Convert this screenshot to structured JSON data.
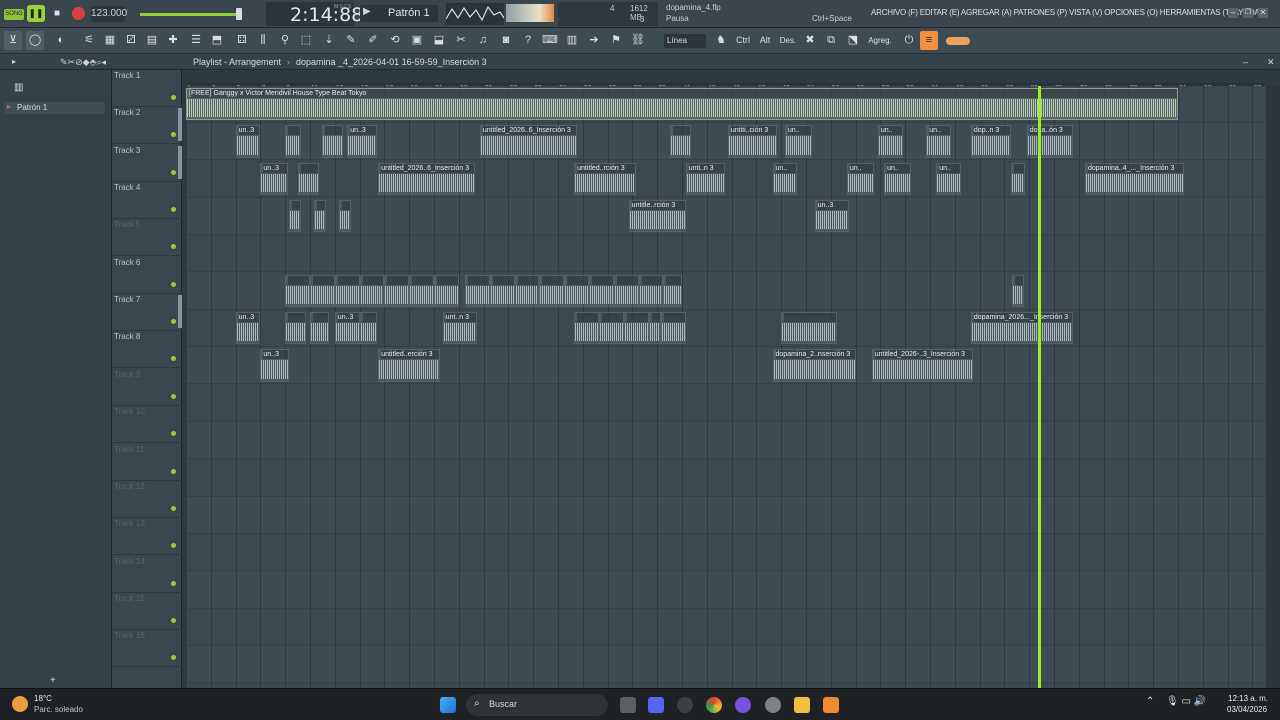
{
  "topbar": {
    "song_mode": "SONG",
    "tempo": "123.000",
    "time": "2:14:88",
    "time_unit": "M:S:CS",
    "pattern": "Patrón 1",
    "cpu": "4",
    "memory": "1612 MB",
    "polyphony": "3",
    "file": "dopamina_4.flp",
    "status": "Pausa",
    "hint": "Ctrl+Space",
    "menu": "ARCHIVO (F) EDITAR (E) AGREGAR (A) PATRONES (P) VISTA (V) OPCIONES (O) HERRAMIENTAS (T) AYUDA"
  },
  "toolbar": {
    "line_mode": "Línea",
    "ctrl": "Ctrl",
    "alt": "Alt",
    "des": "Des.",
    "agreg": "Agreg."
  },
  "playlist": {
    "title": "Playlist - Arrangement",
    "breadcrumb": "dopamina _4_2026-04-01 16-59-59_Inserción 3"
  },
  "browser": {
    "pattern": "Patrón 1"
  },
  "tracks": [
    {
      "name": "Track 1"
    },
    {
      "name": "Track 2"
    },
    {
      "name": "Track 3"
    },
    {
      "name": "Track 4"
    },
    {
      "name": "Track 5",
      "muted": true
    },
    {
      "name": "Track 6"
    },
    {
      "name": "Track 7"
    },
    {
      "name": "Track 8"
    },
    {
      "name": "Track 9",
      "muted": true
    },
    {
      "name": "Track 10",
      "muted": true
    },
    {
      "name": "Track 11",
      "muted": true
    },
    {
      "name": "Track 12",
      "muted": true
    },
    {
      "name": "Track 13",
      "muted": true
    },
    {
      "name": "Track 14",
      "muted": true
    },
    {
      "name": "Track 15",
      "muted": true
    },
    {
      "name": "Track 16",
      "muted": true
    }
  ],
  "ruler": [
    "1",
    "3",
    "5",
    "7",
    "9",
    "11",
    "13",
    "15",
    "17",
    "19",
    "21",
    "23",
    "25",
    "27",
    "29",
    "31",
    "33",
    "35",
    "37",
    "39",
    "41",
    "43",
    "45",
    "47",
    "49",
    "51",
    "53",
    "55",
    "57",
    "59",
    "61",
    "63",
    "65",
    "67",
    "69",
    "71",
    "73",
    "75",
    "77",
    "79",
    "81",
    "83",
    "85",
    "87"
  ],
  "clips": [
    {
      "t": 0,
      "s": 1,
      "e": 81,
      "label": "[FREE] Ganggy x Victor Mendivil House Type Beat Tokyo"
    },
    {
      "t": 1,
      "s": 5,
      "e": 7,
      "label": "un..3"
    },
    {
      "t": 1,
      "s": 9,
      "e": 10.3,
      "label": ""
    },
    {
      "t": 1,
      "s": 12,
      "e": 13.7,
      "label": ""
    },
    {
      "t": 1,
      "s": 14,
      "e": 16.4,
      "label": "un..3"
    },
    {
      "t": 1,
      "s": 24.7,
      "e": 32.5,
      "label": "untitled_2026..6_Inserción 3"
    },
    {
      "t": 1,
      "s": 40,
      "e": 41.7,
      "label": ""
    },
    {
      "t": 1,
      "s": 44.7,
      "e": 48.7,
      "label": "untiti..ción 3"
    },
    {
      "t": 1,
      "s": 49.3,
      "e": 51.5,
      "label": "un.."
    },
    {
      "t": 1,
      "s": 56.8,
      "e": 58.8,
      "label": "un.."
    },
    {
      "t": 1,
      "s": 60.7,
      "e": 62.7,
      "label": "un.."
    },
    {
      "t": 1,
      "s": 64.3,
      "e": 67.5,
      "label": "dop..n 3"
    },
    {
      "t": 1,
      "s": 68.8,
      "e": 72.5,
      "label": "dopa..ón 3"
    },
    {
      "t": 2,
      "s": 7,
      "e": 9.2,
      "label": "un..3"
    },
    {
      "t": 2,
      "s": 10,
      "e": 11.7,
      "label": ""
    },
    {
      "t": 2,
      "s": 16.5,
      "e": 24.3,
      "label": "untitled_2026..6_Inserción 3"
    },
    {
      "t": 2,
      "s": 32.3,
      "e": 37.3,
      "label": "untitled..rción 3"
    },
    {
      "t": 2,
      "s": 41.3,
      "e": 44.5,
      "label": "unti..n 3"
    },
    {
      "t": 2,
      "s": 48.3,
      "e": 50.3,
      "label": "un.."
    },
    {
      "t": 2,
      "s": 54.3,
      "e": 56.5,
      "label": "un.."
    },
    {
      "t": 2,
      "s": 57.3,
      "e": 59.5,
      "label": "un.."
    },
    {
      "t": 2,
      "s": 61.5,
      "e": 63.5,
      "label": "un.."
    },
    {
      "t": 2,
      "s": 67.5,
      "e": 68.7,
      "label": ""
    },
    {
      "t": 2,
      "s": 73.5,
      "e": 81.5,
      "label": "dopamina..4_..._Inserción 3"
    },
    {
      "t": 3,
      "s": 9.3,
      "e": 10.3,
      "label": ""
    },
    {
      "t": 3,
      "s": 11.3,
      "e": 12.3,
      "label": ""
    },
    {
      "t": 3,
      "s": 13.3,
      "e": 14.3,
      "label": ""
    },
    {
      "t": 3,
      "s": 36.7,
      "e": 41.3,
      "label": "untitle..rción 3"
    },
    {
      "t": 3,
      "s": 51.7,
      "e": 54.5,
      "label": "un..3"
    },
    {
      "t": 5,
      "s": 9,
      "e": 11,
      "label": ""
    },
    {
      "t": 5,
      "s": 11,
      "e": 13,
      "label": ""
    },
    {
      "t": 5,
      "s": 13,
      "e": 15,
      "label": ""
    },
    {
      "t": 5,
      "s": 15,
      "e": 17,
      "label": ""
    },
    {
      "t": 5,
      "s": 17,
      "e": 19,
      "label": ""
    },
    {
      "t": 5,
      "s": 19,
      "e": 21,
      "label": ""
    },
    {
      "t": 5,
      "s": 21,
      "e": 23,
      "label": ""
    },
    {
      "t": 5,
      "s": 23.5,
      "e": 25.5,
      "label": ""
    },
    {
      "t": 5,
      "s": 25.5,
      "e": 27.5,
      "label": ""
    },
    {
      "t": 5,
      "s": 27.5,
      "e": 29.5,
      "label": ""
    },
    {
      "t": 5,
      "s": 29.5,
      "e": 31.5,
      "label": ""
    },
    {
      "t": 5,
      "s": 31.5,
      "e": 33.5,
      "label": ""
    },
    {
      "t": 5,
      "s": 33.5,
      "e": 35.5,
      "label": ""
    },
    {
      "t": 5,
      "s": 35.5,
      "e": 37.5,
      "label": ""
    },
    {
      "t": 5,
      "s": 37.5,
      "e": 39.5,
      "label": ""
    },
    {
      "t": 5,
      "s": 39.5,
      "e": 41,
      "label": ""
    },
    {
      "t": 5,
      "s": 67.6,
      "e": 68.6,
      "label": ""
    },
    {
      "t": 6,
      "s": 5,
      "e": 7,
      "label": "un..3"
    },
    {
      "t": 6,
      "s": 9,
      "e": 10.7,
      "label": ""
    },
    {
      "t": 6,
      "s": 11,
      "e": 12.5,
      "label": ""
    },
    {
      "t": 6,
      "s": 13,
      "e": 15,
      "label": "un..3"
    },
    {
      "t": 6,
      "s": 15,
      "e": 16.4,
      "label": ""
    },
    {
      "t": 6,
      "s": 21.7,
      "e": 24.5,
      "label": "unt..n 3"
    },
    {
      "t": 6,
      "s": 32.3,
      "e": 34.3,
      "label": ""
    },
    {
      "t": 6,
      "s": 34.3,
      "e": 36.3,
      "label": ""
    },
    {
      "t": 6,
      "s": 36.3,
      "e": 38.3,
      "label": ""
    },
    {
      "t": 6,
      "s": 38.3,
      "e": 39.3,
      "label": ""
    },
    {
      "t": 6,
      "s": 39.3,
      "e": 41.3,
      "label": ""
    },
    {
      "t": 6,
      "s": 49,
      "e": 53.5,
      "label": ""
    },
    {
      "t": 6,
      "s": 64.3,
      "e": 72.5,
      "label": "dopamina_2026..._Inserción 3"
    },
    {
      "t": 7,
      "s": 7,
      "e": 9.3,
      "label": "un..3"
    },
    {
      "t": 7,
      "s": 16.5,
      "e": 21.5,
      "label": "untitled..erción 3"
    },
    {
      "t": 7,
      "s": 48.3,
      "e": 55,
      "label": "dopamina_2..nserción 3"
    },
    {
      "t": 7,
      "s": 56.3,
      "e": 64.5,
      "label": "untitled_2026-..3_Inserción 3"
    }
  ],
  "taskbar": {
    "weather_temp": "18°C",
    "weather_desc": "Parc. soleado",
    "search": "Buscar",
    "clock_time": "12:13 a. m.",
    "clock_date": "03/04/2026"
  }
}
